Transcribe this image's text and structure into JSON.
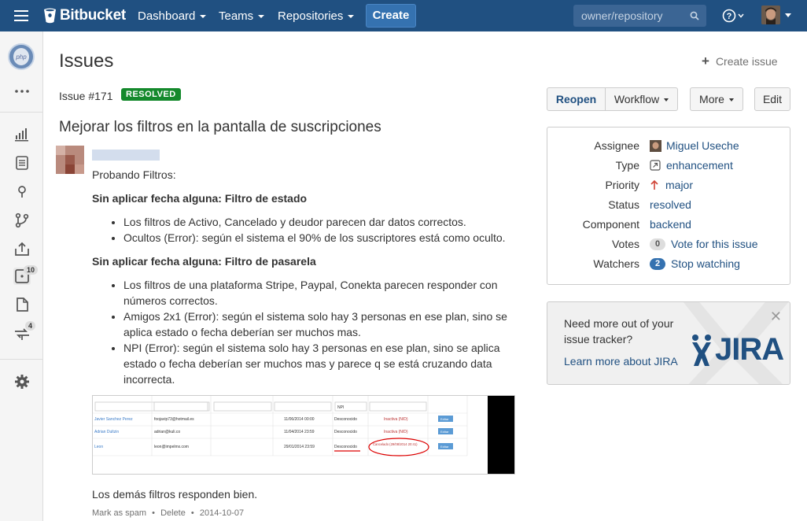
{
  "topnav": {
    "brand": "Bitbucket",
    "dashboard": "Dashboard",
    "teams": "Teams",
    "repositories": "Repositories",
    "create": "Create",
    "search_placeholder": "owner/repository"
  },
  "sidebar": {
    "items": [
      {
        "icon": "repo-php-avatar-icon"
      },
      {
        "icon": "more-icon"
      },
      {
        "icon": "overview-chart-icon"
      },
      {
        "icon": "source-icon"
      },
      {
        "icon": "commits-icon"
      },
      {
        "icon": "branches-icon"
      },
      {
        "icon": "pull-requests-icon"
      },
      {
        "icon": "issues-icon",
        "badge": "10"
      },
      {
        "icon": "downloads-icon"
      },
      {
        "icon": "forks-icon",
        "badge": "4"
      },
      {
        "icon": "settings-gear-icon"
      }
    ]
  },
  "page": {
    "title": "Issues",
    "create_issue": "Create issue"
  },
  "issue": {
    "number": "Issue #171",
    "status": "RESOLVED",
    "title": "Mejorar los filtros en la pantalla de suscripciones",
    "buttons": {
      "reopen": "Reopen",
      "workflow": "Workflow",
      "more": "More",
      "edit": "Edit"
    },
    "meta": {
      "assignee_label": "Assignee",
      "assignee": "Miguel Useche",
      "type_label": "Type",
      "type": "enhancement",
      "priority_label": "Priority",
      "priority": "major",
      "status_label": "Status",
      "status": "resolved",
      "component_label": "Component",
      "component": "backend",
      "votes_label": "Votes",
      "votes_count": "0",
      "votes_link": "Vote for this issue",
      "watchers_label": "Watchers",
      "watchers_count": "2",
      "watchers_link": "Stop watching"
    }
  },
  "promo": {
    "text": "Need more out of your issue tracker?",
    "link": "Learn more about JIRA",
    "logo": "JIRA"
  },
  "comment": {
    "intro": "Probando Filtros:",
    "h1": "Sin aplicar fecha alguna: Filtro de estado",
    "list1": [
      "Los filtros de Activo, Cancelado y deudor parecen dar datos correctos.",
      "Ocultos (Error): según el sistema el 90% de los suscriptores está como oculto."
    ],
    "h2": "Sin aplicar fecha alguna: Filtro de pasarela",
    "list2": [
      "Los filtros de una plataforma Stripe, Paypal, Conekta parecen responder con números correctos.",
      "Amigos 2x1 (Error): según el sistema solo hay 3 personas en ese plan, sino se aplica estado o fecha deberían ser muchos mas.",
      "NPI (Error): según el sistema solo hay 3 personas en ese plan, sino se aplica estado o fecha deberían ser muchos mas y parece q se está cruzando data incorrecta."
    ],
    "screenshot": {
      "filter": "NPI",
      "rows": [
        {
          "name": "Javier Sanchez Perez",
          "email": "foojavip73@hotmail.es",
          "date": "11/06/2014 00:00",
          "gateway": "Desconocido",
          "status": "Inactiva (N/D)",
          "btn": "Editar"
        },
        {
          "name": "Adrian Dultzin",
          "email": "adrian@kuli.co",
          "date": "11/04/2014 23:59",
          "gateway": "Desconocido",
          "status": "Inactiva (N/D)",
          "btn": "Editar"
        },
        {
          "name": "Leon",
          "email": "leon@impelmx.com",
          "date": "29/01/2014 23:59",
          "gateway": "Desconocido",
          "status": "Cancelado (29/08/2014 20:41)",
          "btn": "Editar"
        }
      ]
    },
    "outro": "Los demás filtros responden bien.",
    "action_spam": "Mark as spam",
    "action_delete": "Delete",
    "date": "2014-10-07"
  },
  "colors": {
    "nav": "#205081",
    "link": "#205081",
    "resolved": "#14892c",
    "priority_major": "#d04437"
  }
}
